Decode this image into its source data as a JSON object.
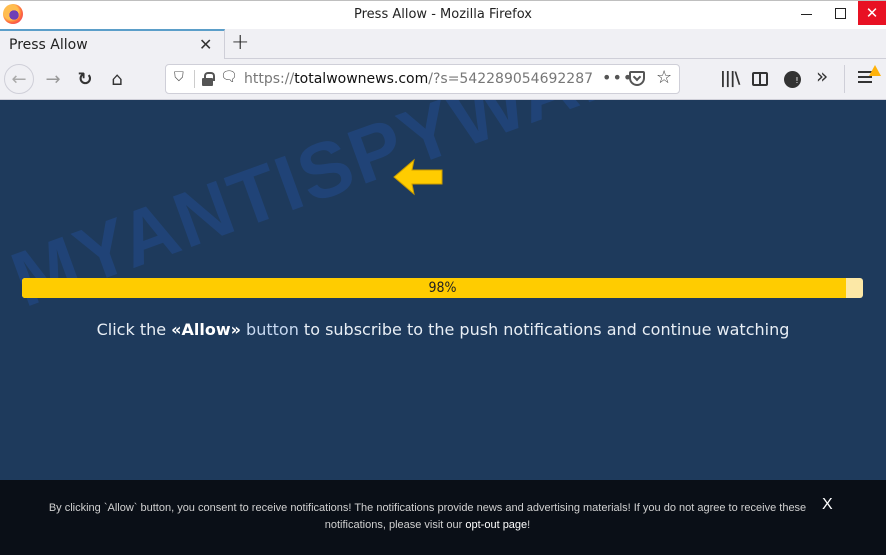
{
  "window": {
    "title": "Press Allow - Mozilla Firefox",
    "minimize_icon": "minimize-icon",
    "maximize_icon": "maximize-icon",
    "close_glyph": "✕"
  },
  "tabs": [
    {
      "label": "Press Allow",
      "active": true,
      "close_glyph": "✕"
    }
  ],
  "new_tab_glyph": "+",
  "nav": {
    "back_glyph": "←",
    "forward_glyph": "→",
    "reload_glyph": "↻",
    "home_glyph": "⌂",
    "url_prefix": "https://",
    "url_host": "totalwownews.com",
    "url_rest": "/?s=542289054692287",
    "more_glyph": "•••",
    "star_glyph": "☆",
    "shield_glyph": "⛉",
    "notif_glyph": "🗨",
    "library_glyph": "|||\\",
    "overflow_glyph": "»"
  },
  "page": {
    "accent_color": "#ffcc00",
    "background_color": "#1e3a5c",
    "progress": {
      "percent": 98,
      "label": "98%"
    },
    "message_before": "Click the ",
    "message_allow": "«Allow»",
    "message_button": " button",
    "message_after": " to subscribe to the push notifications and continue watching",
    "watermark": "MYANTISPYWARE.COM"
  },
  "footer": {
    "text": "By clicking `Allow` button, you consent to receive notifications! The notifications provide news and advertising materials! If you do not agree to receive these notifications, please visit our ",
    "link": "opt-out page",
    "suffix": "!",
    "close_glyph": "X"
  }
}
